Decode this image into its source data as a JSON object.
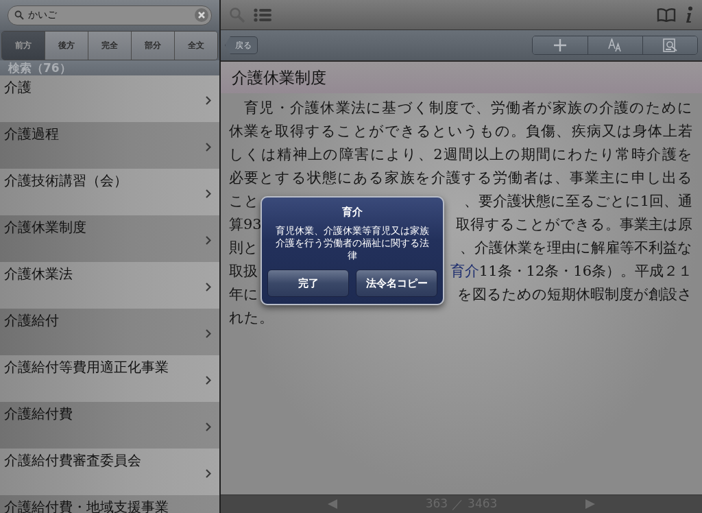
{
  "search": {
    "value": "かいご"
  },
  "scope_tabs": [
    {
      "label": "前方",
      "selected": true
    },
    {
      "label": "後方",
      "selected": false
    },
    {
      "label": "完全",
      "selected": false
    },
    {
      "label": "部分",
      "selected": false
    },
    {
      "label": "全文",
      "selected": false
    }
  ],
  "results_header": "検索（76）",
  "results": [
    "介護",
    "介護過程",
    "介護技術講習（会）",
    "介護休業制度",
    "介護休業法",
    "介護給付",
    "介護給付等費用適正化事業",
    "介護給付費",
    "介護給付費審査委員会",
    "介護給付費・地域支援事業"
  ],
  "back_button": "戻る",
  "entry": {
    "title": "介護休業制度",
    "lines": [
      {
        "kind": "full",
        "text": "　育児・介護休業法に基づく制度で、労働者が家族の介護のために"
      },
      {
        "kind": "full",
        "text": "休業を取得することができるというもの。負傷、疾病又は身体上若"
      },
      {
        "kind": "full",
        "text": "しくは精神上の障害により、2週間以上の期間にわたり常時介護を"
      },
      {
        "kind": "full",
        "text": "必要とする状態にある家族を介護する労働者は、事業主に申し出る"
      },
      {
        "kind": "split",
        "left": "こと",
        "right": "、要介護状態に至るごとに1回、通"
      },
      {
        "kind": "split",
        "left": "算93",
        "right": "取得することができる。事業主は原"
      },
      {
        "kind": "split",
        "left": "則と",
        "right": "、介護休業を理由に解雇等不利益な"
      },
      {
        "kind": "split",
        "left": "取扱",
        "link": "育介",
        "right": "11条・12条・16条）。平成２１"
      },
      {
        "kind": "split",
        "left": "年に",
        "right": "を図るための短期休暇制度が創設さ"
      },
      {
        "kind": "last",
        "text": "れた。"
      }
    ]
  },
  "pager": {
    "current": "363",
    "separator": "／",
    "total": "3463"
  },
  "dialog": {
    "title": "育介",
    "message": "育児休業、介護休業等育児又は家族介護を行う労働者の福祉に関する法律",
    "buttons": [
      "完了",
      "法令名コピー"
    ]
  }
}
